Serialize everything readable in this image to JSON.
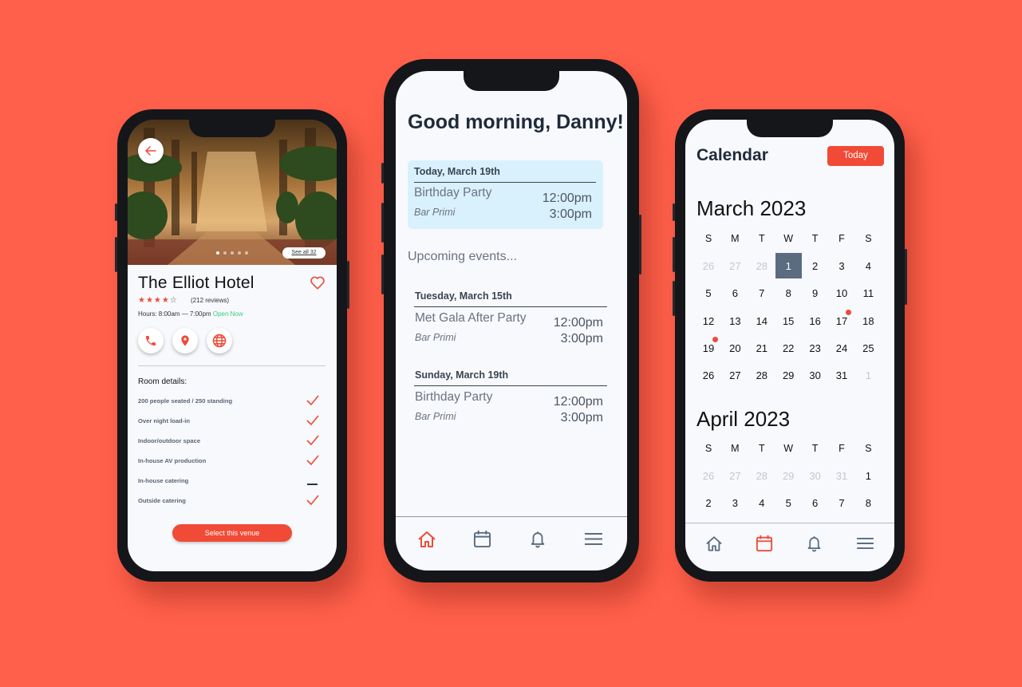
{
  "colors": {
    "background": "#ff604b",
    "accent": "#f14a36",
    "event_card": "#d9f1fc",
    "selected_day": "#5b6b80",
    "open_green": "#3ccb7f"
  },
  "hotel": {
    "back_icon": "arrow-left-icon",
    "see_all": "See all 32",
    "name": "The Elliot Hotel",
    "rating_stars": "★★★★",
    "rating_empty": "☆",
    "rating_value": 4,
    "rating_max": 5,
    "reviews": "(212 reviews)",
    "hours": "Hours: 8:00am — 7:00pm",
    "open_status": "Open Now",
    "actions": [
      "phone-icon",
      "location-pin-icon",
      "globe-icon"
    ],
    "room_details_title": "Room details:",
    "amenities": [
      {
        "label": "200 people seated / 250 standing",
        "status": "check"
      },
      {
        "label": "Over night load-in",
        "status": "check"
      },
      {
        "label": "Indoor/outdoor space",
        "status": "check"
      },
      {
        "label": "In-house AV production",
        "status": "check"
      },
      {
        "label": "In-house catering",
        "status": "dash"
      },
      {
        "label": "Outside catering",
        "status": "check"
      }
    ],
    "select_button": "Select this venue"
  },
  "home": {
    "greeting": "Good morning, Danny!",
    "today": {
      "date": "Today, March 19th",
      "name": "Birthday Party",
      "location": "Bar Primi",
      "start": "12:00pm",
      "end": "3:00pm"
    },
    "upcoming_label": "Upcoming events...",
    "upcoming": [
      {
        "date": "Tuesday, March 15th",
        "name": "Met Gala After Party",
        "location": "Bar Primi",
        "start": "12:00pm",
        "end": "3:00pm"
      },
      {
        "date": "Sunday, March 19th",
        "name": "Birthday Party",
        "location": "Bar Primi",
        "start": "12:00pm",
        "end": "3:00pm"
      }
    ],
    "nav": [
      "home-icon",
      "calendar-icon",
      "bell-icon",
      "menu-icon"
    ],
    "active_nav": "home-icon"
  },
  "calendar": {
    "title": "Calendar",
    "today_button": "Today",
    "weekdays": [
      "S",
      "M",
      "T",
      "W",
      "T",
      "F",
      "S"
    ],
    "march": {
      "label": "March 2023",
      "weeks": [
        [
          "26",
          "27",
          "28",
          "1",
          "2",
          "3",
          "4"
        ],
        [
          "5",
          "6",
          "7",
          "8",
          "9",
          "10",
          "11"
        ],
        [
          "12",
          "13",
          "14",
          "15",
          "16",
          "17",
          "18"
        ],
        [
          "19",
          "20",
          "21",
          "22",
          "23",
          "24",
          "25"
        ],
        [
          "26",
          "27",
          "28",
          "29",
          "30",
          "31",
          "1"
        ]
      ],
      "selected": "1",
      "event_days": [
        "17",
        "19"
      ]
    },
    "april": {
      "label": "April 2023",
      "weeks": [
        [
          "26",
          "27",
          "28",
          "29",
          "30",
          "31",
          "1"
        ],
        [
          "2",
          "3",
          "4",
          "5",
          "6",
          "7",
          "8"
        ]
      ]
    },
    "nav": [
      "home-icon",
      "calendar-icon",
      "bell-icon",
      "menu-icon"
    ],
    "active_nav": "calendar-icon"
  }
}
